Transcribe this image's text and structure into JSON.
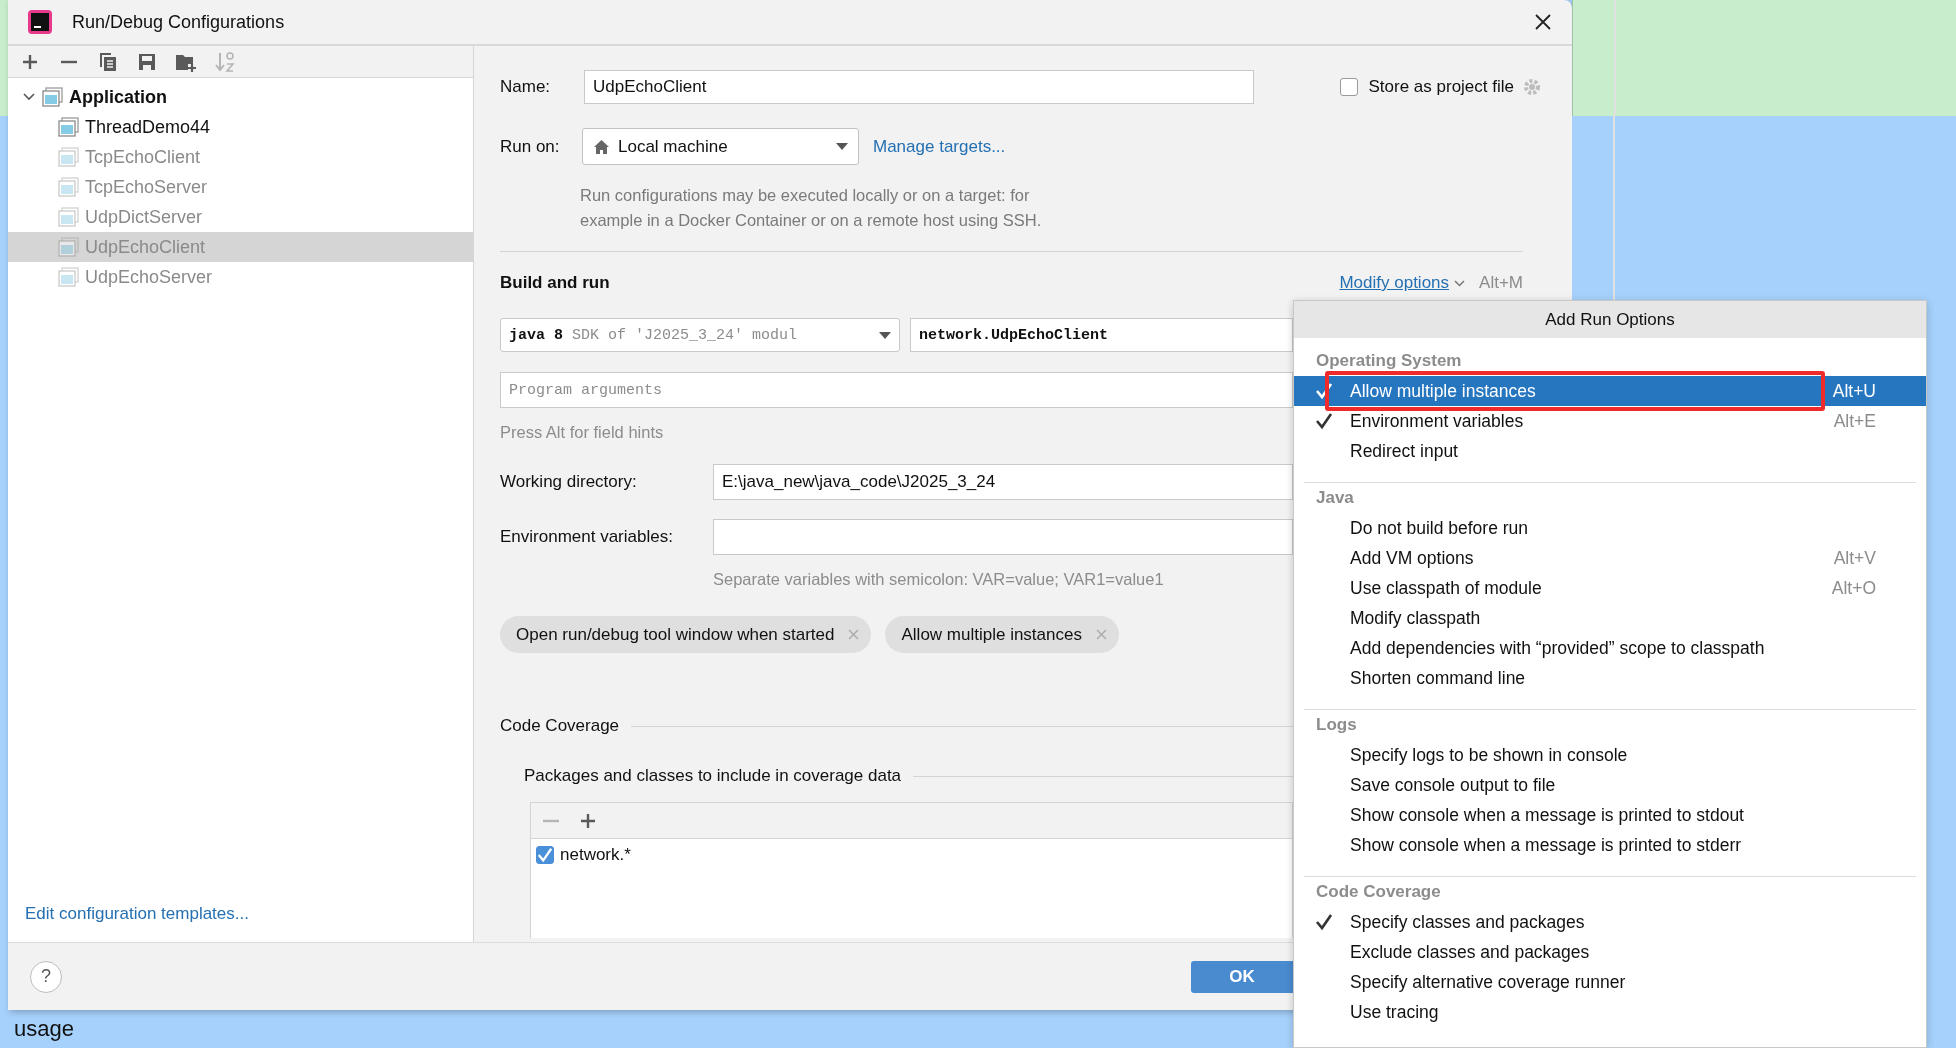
{
  "window": {
    "title": "Run/Debug Configurations"
  },
  "toolbar": [
    {
      "kind": "add",
      "disabled": false
    },
    {
      "kind": "remove",
      "disabled": false
    },
    {
      "kind": "copy",
      "disabled": false
    },
    {
      "kind": "save",
      "disabled": false
    },
    {
      "kind": "folder",
      "disabled": false
    },
    {
      "kind": "sort",
      "disabled": true
    }
  ],
  "tree": {
    "label": "Application",
    "expanded": true,
    "children": [
      {
        "label": "ThreadDemo44",
        "temporary": false,
        "selected": false
      },
      {
        "label": "TcpEchoClient",
        "temporary": true,
        "selected": false
      },
      {
        "label": "TcpEchoServer",
        "temporary": true,
        "selected": false
      },
      {
        "label": "UdpDictServer",
        "temporary": true,
        "selected": false
      },
      {
        "label": "UdpEchoClient",
        "temporary": true,
        "selected": true
      },
      {
        "label": "UdpEchoServer",
        "temporary": true,
        "selected": false
      }
    ]
  },
  "templates_link": "Edit configuration templates...",
  "form": {
    "name_label": "Name:",
    "name_value": "UdpEchoClient",
    "store": {
      "label": "Store as project file",
      "checked": false
    },
    "run_on_label": "Run on:",
    "run_on_value": "Local machine",
    "manage_link": "Manage targets...",
    "run_on_hint": "Run configurations may be executed locally or on a target: for example in a Docker Container or on a remote host using SSH.",
    "build_title": "Build and run",
    "modify_link": "Modify options",
    "modify_shortcut": "Alt+M",
    "jdk": "java 8",
    "jdk_detail": "SDK of 'J2025_3_24' modul",
    "main_class": "network.UdpEchoClient",
    "args_placeholder": "Program arguments",
    "alt_hint": "Press Alt for field hints",
    "workdir_label": "Working directory:",
    "workdir_value": "E:\\java_new\\java_code\\J2025_3_24",
    "env_label": "Environment variables:",
    "env_hint": "Separate variables with semicolon: VAR=value; VAR1=value1",
    "chips": [
      "Open run/debug tool window when started",
      "Allow multiple instances"
    ],
    "coverage_title": "Code Coverage",
    "packages_title": "Packages and classes to include in coverage data",
    "packages_toolbar": [
      {
        "kind": "remove",
        "disabled": true
      },
      {
        "kind": "add",
        "disabled": false
      }
    ],
    "packages": [
      {
        "label": "network.*",
        "checked": true
      }
    ]
  },
  "buttons": {
    "help": "?",
    "ok": "OK"
  },
  "popup": {
    "title": "Add Run Options",
    "sections": [
      {
        "title": "Operating System",
        "items": [
          {
            "label": "Allow multiple instances",
            "shortcut": "Alt+U",
            "checked": true,
            "selected": true,
            "outlined": true
          },
          {
            "label": "Environment variables",
            "shortcut": "Alt+E",
            "checked": true,
            "selected": false,
            "outlined": false
          },
          {
            "label": "Redirect input",
            "checked": false,
            "selected": false,
            "outlined": false
          }
        ]
      },
      {
        "title": "Java",
        "items": [
          {
            "label": "Do not build before run",
            "checked": false,
            "selected": false,
            "outlined": false
          },
          {
            "label": "Add VM options",
            "shortcut": "Alt+V",
            "checked": false,
            "selected": false,
            "outlined": false
          },
          {
            "label": "Use classpath of module",
            "shortcut": "Alt+O",
            "checked": false,
            "selected": false,
            "outlined": false
          },
          {
            "label": "Modify classpath",
            "checked": false,
            "selected": false,
            "outlined": false
          },
          {
            "label": "Add dependencies with “provided” scope to classpath",
            "checked": false,
            "selected": false,
            "outlined": false
          },
          {
            "label": "Shorten command line",
            "checked": false,
            "selected": false,
            "outlined": false
          }
        ]
      },
      {
        "title": "Logs",
        "items": [
          {
            "label": "Specify logs to be shown in console",
            "checked": false,
            "selected": false,
            "outlined": false
          },
          {
            "label": "Save console output to file",
            "checked": false,
            "selected": false,
            "outlined": false
          },
          {
            "label": "Show console when a message is printed to stdout",
            "checked": false,
            "selected": false,
            "outlined": false
          },
          {
            "label": "Show console when a message is printed to stderr",
            "checked": false,
            "selected": false,
            "outlined": false
          }
        ]
      },
      {
        "title": "Code Coverage",
        "items": [
          {
            "label": "Specify classes and packages",
            "checked": true,
            "selected": false,
            "outlined": false
          },
          {
            "label": "Exclude classes and packages",
            "checked": false,
            "selected": false,
            "outlined": false
          },
          {
            "label": "Specify alternative coverage runner",
            "checked": false,
            "selected": false,
            "outlined": false
          },
          {
            "label": "Use tracing",
            "checked": false,
            "selected": false,
            "outlined": false
          }
        ]
      }
    ]
  },
  "background": {
    "text": "usage"
  }
}
